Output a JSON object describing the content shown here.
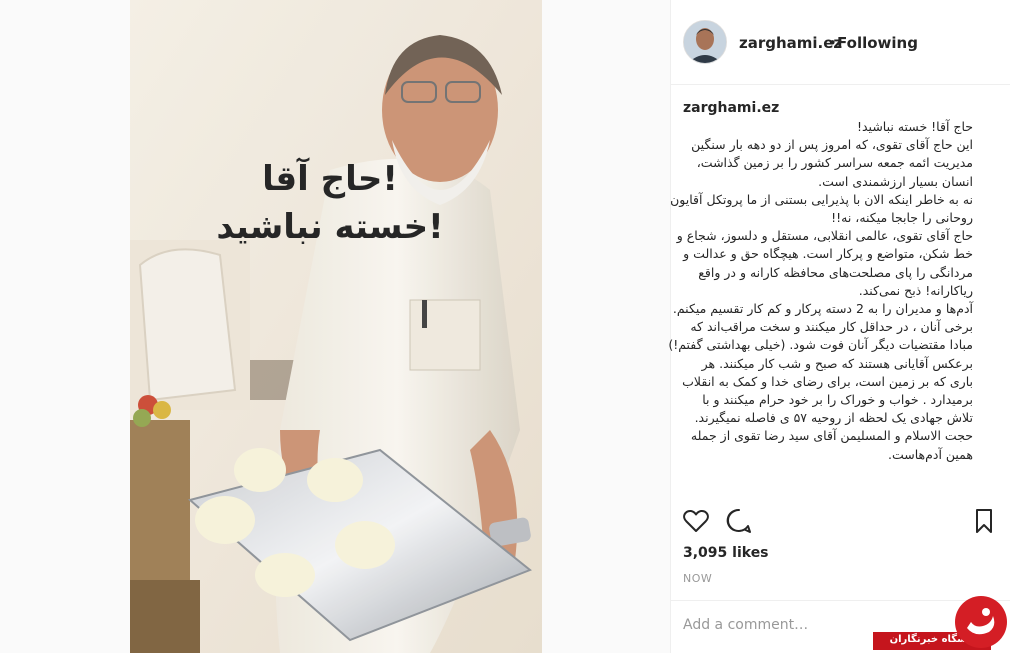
{
  "post_image": {
    "overlay_line1": "حاج آقا!",
    "overlay_line2": "خسته نباشید!"
  },
  "header": {
    "username": "zarghami.ez",
    "separator": "•",
    "follow_status": "Following"
  },
  "caption": {
    "username": "zarghami.ez",
    "trail": ".",
    "lines": [
      "حاج آقا! خسته نباشید!",
      "این حاج آقای تقوی، که امروز پس از دو دهه بار سنگین",
      "مدیریت ائمه جمعه سراسر کشور را بر زمین گذاشت،",
      "انسان بسیار ارزشمندی است.",
      "نه به خاطر اینکه الان با پذیرایی بستنی از ما پروتکل آقایون",
      "روحانی را جابجا میکنه، نه!!",
      "حاج آقای تقوی، عالمی انقلابی، مستقل و دلسوز، شجاع و",
      "خط شکن، متواضع و پرکار است. هیچگاه حق و عدالت و",
      "مردانگی را پای مصلحت‌های محافظه کارانه و در واقع",
      "ریاکارانه! ذبح نمی‌کند.",
      "آدم‌ها و مدیران را به 2 دسته پرکار و کم کار تقسیم میکنم.",
      "برخی آنان ، در حداقل کار میکنند و سخت مراقب‌اند که",
      "مبادا مقتضیات دیگر آنان فوت شود. (خیلی بهداشتی گفتم!)",
      "برعکس آقایانی هستند که صبح و شب کار میکنند. هر",
      "باری که بر زمین است، برای رضای خدا و کمک به انقلاب",
      "برمیدارد . خواب و خوراک را بر خود حرام میکنند و با",
      "تلاش جهادی یک لحظه از روحیه ۵۷ ی فاصله نمیگیرند.",
      "حجت الاسلام و المسلیمن آقای سید رضا تقوی از جمله",
      "همین آدم‌هاست."
    ]
  },
  "actions": {
    "like_icon": "heart-outline-icon",
    "comment_icon": "speech-bubble-icon",
    "save_icon": "bookmark-icon"
  },
  "likes": "3,095 likes",
  "timestamp": "NOW",
  "comment_placeholder": "Add a comment…",
  "watermark": {
    "text": "باشگاه خبرنگاران"
  },
  "colors": {
    "text": "#262626",
    "muted": "#999999",
    "border": "#efefef",
    "watermark_red": "#c5151d"
  }
}
